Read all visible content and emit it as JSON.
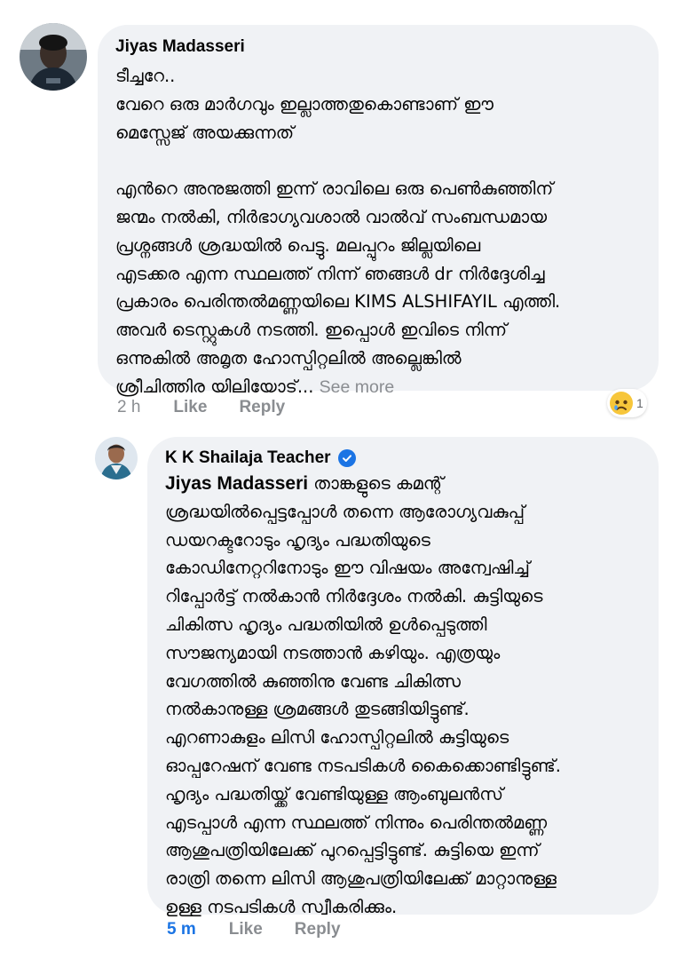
{
  "comment": {
    "author": "Jiyas Madasseri",
    "text": "ടീച്ചറേ..\nവേറെ ഒരു മാർഗവും ഇല്ലാത്തതുകൊണ്ടാണ് ഈ\nമെസ്സേജ് അയക്കുന്നത്\n\nഎൻറെ അനുജത്തി ഇന്ന് രാവിലെ ഒരു പെൺകുഞ്ഞിന്\nജന്മം നൽകി, നിർഭാഗ്യവശാൽ വാൽവ് സംബന്ധമായ\nപ്രശ്നങ്ങൾ ശ്രദ്ധയിൽ പെട്ടു. മലപ്പുറം ജില്ലയിലെ\nഎടക്കര എന്ന സ്ഥലത്ത് നിന്ന് ഞങ്ങൾ dr നിർദ്ദേശിച്ച\nപ്രകാരം പെരിന്തൽമണ്ണയിലെ KIMS ALSHIFAYIL എത്തി.\nഅവർ ടെസ്റ്റുകൾ നടത്തി. ഇപ്പൊൾ ഇവിടെ നിന്ന്\nഒന്നുകിൽ അമൃത ഹോസ്പിറ്റലിൽ അല്ലെങ്കിൽ\nശ്രീചിത്തിര യിലിയോട്...",
    "see_more": "See more",
    "time": "2 h",
    "like": "Like",
    "reply": "Reply",
    "reaction_count": "1",
    "reaction_icon": "sad-face-icon"
  },
  "reply_comment": {
    "author": "K K Shailaja Teacher",
    "verified_icon": "verified-badge-icon",
    "mention": "Jiyas Madasseri",
    "text": " താങ്കളുടെ കമന്റ്\nശ്രദ്ധയിൽപ്പെട്ടപ്പോൾ തന്നെ ആരോഗ്യവകുപ്പ്\nഡയറക്ടറോടും ഹൃദ്യം പദ്ധതിയുടെ\nകോഡിനേറ്ററിനോടും ഈ വിഷയം അന്വേഷിച്ച്\nറിപ്പോർട്ട് നൽകാൻ നിർദ്ദേശം നൽകി. കുട്ടിയുടെ\nചികിത്സ ഹൃദ്യം പദ്ധതിയിൽ ഉൾപ്പെടുത്തി\nസൗജന്യമായി നടത്താൻ കഴിയും. എത്രയും\nവേഗത്തിൽ കുഞ്ഞിനു വേണ്ട ചികിത്സ\nനൽകാനുള്ള ശ്രമങ്ങൾ തുടങ്ങിയിട്ടുണ്ട്.\nഎറണാകുളം ലിസി ഹോസ്പിറ്റലിൽ കുട്ടിയുടെ\nഓപ്പറേഷന് വേണ്ട നടപടികൾ കൈക്കൊണ്ടിട്ടുണ്ട്.\nഹൃദ്യം പദ്ധതിയ്ക്ക് വേണ്ടിയുള്ള ആംബുലൻസ്\nഎടപ്പാൾ എന്ന സ്ഥലത്ത് നിന്നും പെരിന്തൽമണ്ണ\nആശുപത്രിയിലേക്ക് പുറപ്പെട്ടിട്ടുണ്ട്. കുട്ടിയെ ഇന്ന്\nരാത്രി തന്നെ ലിസി ആശുപത്രിയിലേക്ക് മാറ്റാനുള്ള\nഉള്ള നടപടികൾ സ്വീകരിക്കും.",
    "time": "5 m",
    "like": "Like",
    "reply": "Reply"
  },
  "colors": {
    "bubble": "#f0f2f5",
    "meta_text": "#8a8d91",
    "link_blue": "#1b74e4",
    "text": "#050505"
  }
}
